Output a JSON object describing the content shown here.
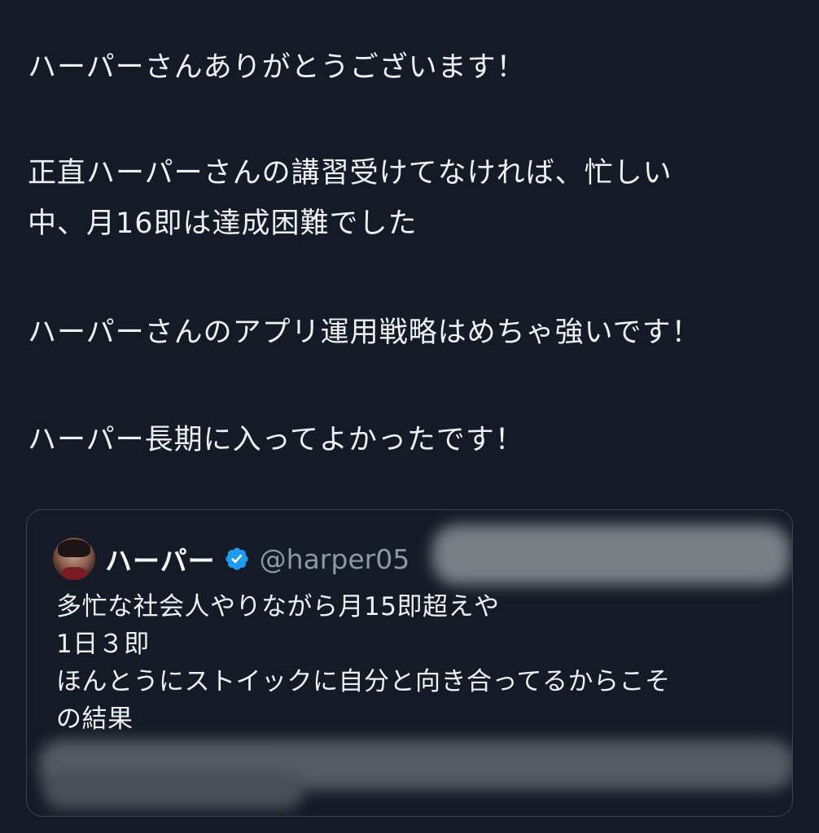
{
  "tweet": {
    "lines": [
      "ハーパーさんありがとうございます！",
      "",
      "正直ハーパーさんの講習受けてなければ、忙しい",
      "中、月16即は達成困難でした",
      "",
      "ハーパーさんのアプリ運用戦略はめちゃ強いです！",
      "",
      "ハーパー長期に入ってよかったです！"
    ]
  },
  "quote": {
    "display_name": "ハーパー",
    "handle": "@harper05",
    "avatar_icon": "user-avatar",
    "verified_icon": "verified-badge-icon",
    "verified_color": "#1d9bf0",
    "lines": [
      "多忙な社会人やりながら月15即超えや",
      "1日３即",
      "ほんとうにストイックに自分と向き合ってるからこそ",
      "の結果"
    ]
  },
  "colors": {
    "background": "#141b26",
    "text": "#eef0f2",
    "muted": "#8b98a5",
    "border": "#3a4452"
  }
}
